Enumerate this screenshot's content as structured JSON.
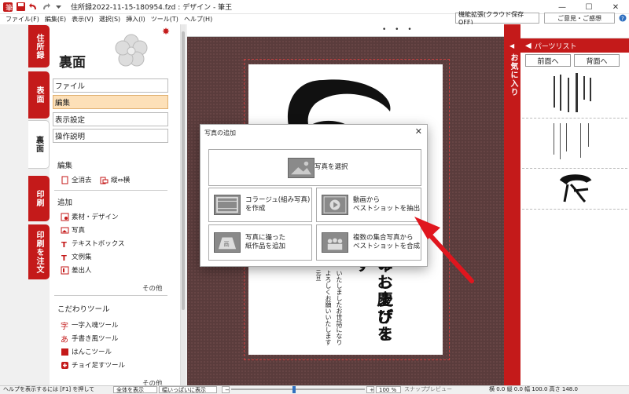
{
  "window": {
    "title": "住所録2022-11-15-180954.fzd : デザイン - 筆王",
    "controls": {
      "minimize": "—",
      "maximize": "☐",
      "close": "✕"
    }
  },
  "menubar": {
    "items": [
      "ファイル(F)",
      "編集(E)",
      "表示(V)",
      "選択(S)",
      "挿入(I)",
      "ツール(T)",
      "ヘルプ(H)"
    ],
    "expand_button": "機能拡張(クラウド保存OFF)",
    "feedback_button": "ご意見・ご感想"
  },
  "side_tabs": [
    "住所録",
    "表面",
    "裏面",
    "印刷",
    "印刷を注文"
  ],
  "panel": {
    "title": "裏面",
    "menu": [
      "ファイル",
      "編集",
      "表示設定",
      "操作説明"
    ],
    "edit_section": {
      "heading": "編集",
      "clear_all": "全消去",
      "orientation": "縦⇔横"
    },
    "add_section": {
      "heading": "追加",
      "items": [
        "素材・デザイン",
        "写真",
        "テキストボックス",
        "文例集",
        "差出人"
      ],
      "more": "その他"
    },
    "tools_section": {
      "heading": "こだわりツール",
      "items": [
        "一字入魂ツール",
        "手書き風ツール",
        "はんこツール",
        "チョイ足すツール"
      ],
      "more": "その他"
    }
  },
  "canvas": {
    "dots": "• • •",
    "card_text": {
      "col1": "のお慶びを",
      "col2": "申し上げます",
      "col3": "いたしましたお世話になり",
      "col4": "よろしくお願いいたします",
      "col5": "元旦"
    }
  },
  "dialog": {
    "title": "写真の追加",
    "close": "✕",
    "buttons": [
      "写真を選択",
      "コラージュ(組み写真)\nを作成",
      "動画から\nベストショットを抽出",
      "写真に撮った\n紙作品を追加",
      "複数の集合写真から\nベストショットを合成"
    ]
  },
  "favorites": {
    "label": "お気に入り",
    "arrow": "◀"
  },
  "parts_list": {
    "header": "パーツリスト",
    "front_button": "前面へ",
    "back_button": "背面へ"
  },
  "statusbar": {
    "help": "ヘルプを表示するには [F1] を押して",
    "show_all": "全体を表示",
    "fit_width": "幅いっぱいに表示",
    "zoom": "100 %",
    "snap": "スナップ",
    "preview": "プレビュー",
    "coords": "横 0.0 縦 0.0 幅 100.0 高さ 148.0"
  },
  "colors": {
    "accent": "#c41a1a",
    "selected": "#fde0b8",
    "canvas": "#5a3c3c"
  }
}
